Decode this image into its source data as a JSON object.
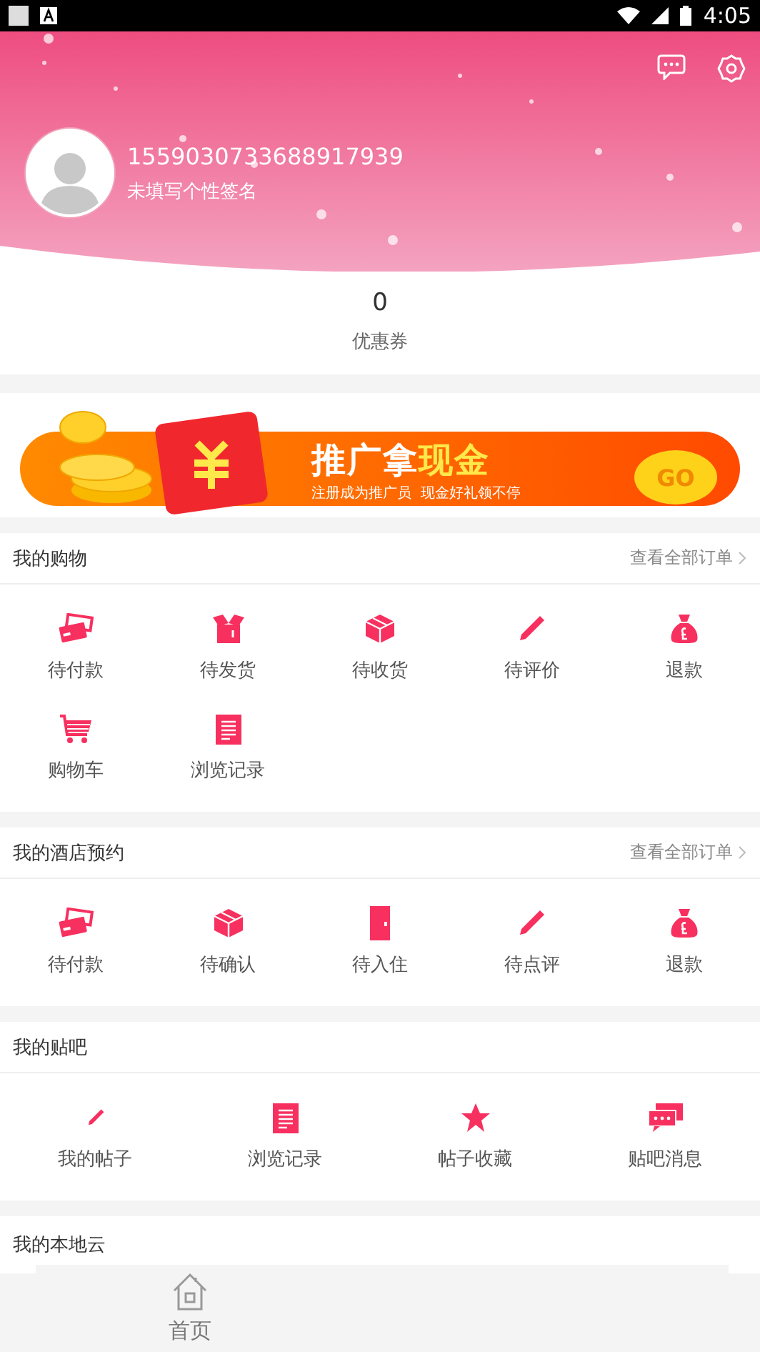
{
  "status_bar": {
    "time": "4:05"
  },
  "header": {
    "username": "1559030733688917939",
    "signature": "未填写个性签名"
  },
  "coupon": {
    "count": "0",
    "label": "优惠券"
  },
  "banner": {
    "title_parts": [
      {
        "text": "推广拿",
        "highlight": false
      },
      {
        "text": "现金",
        "highlight": true
      }
    ],
    "subtitle": "注册成为推广员  现金好礼领不停",
    "button": "GO"
  },
  "sections": [
    {
      "title": "我的购物",
      "link": "查看全部订单",
      "items": [
        {
          "kind": "cards",
          "label": "待付款"
        },
        {
          "kind": "open-box",
          "label": "待发货"
        },
        {
          "kind": "box",
          "label": "待收货"
        },
        {
          "kind": "pencil",
          "label": "待评价"
        },
        {
          "kind": "money-bag",
          "label": "退款"
        },
        {
          "kind": "cart",
          "label": "购物车"
        },
        {
          "kind": "clipboard",
          "label": "浏览记录"
        }
      ]
    },
    {
      "title": "我的酒店预约",
      "link": "查看全部订单",
      "items": [
        {
          "kind": "cards",
          "label": "待付款"
        },
        {
          "kind": "box",
          "label": "待确认"
        },
        {
          "kind": "door",
          "label": "待入住"
        },
        {
          "kind": "pencil",
          "label": "待点评"
        },
        {
          "kind": "money-bag",
          "label": "退款"
        }
      ]
    },
    {
      "title": "我的贴吧",
      "items": [
        {
          "kind": "small-pencil",
          "label": "我的帖子"
        },
        {
          "kind": "clipboard",
          "label": "浏览记录"
        },
        {
          "kind": "star",
          "label": "帖子收藏"
        },
        {
          "kind": "chat",
          "label": "贴吧消息"
        }
      ]
    },
    {
      "title": "我的本地云"
    }
  ],
  "nav": [
    {
      "label": "首页"
    }
  ]
}
